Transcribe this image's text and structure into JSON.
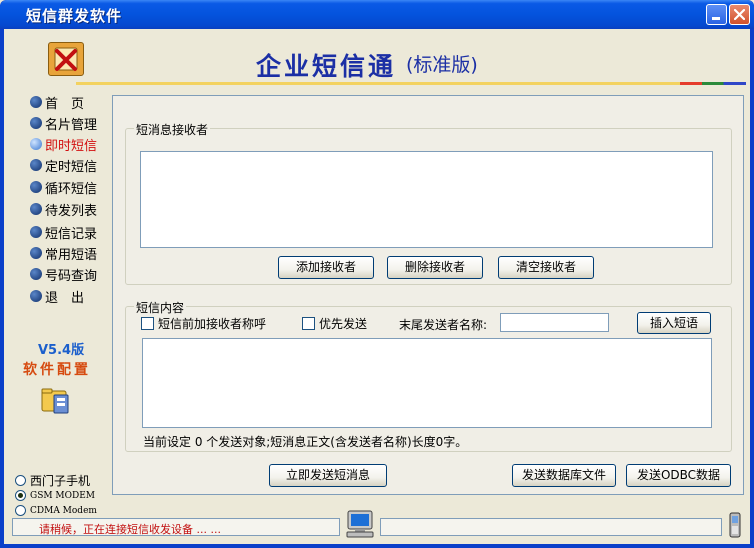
{
  "window": {
    "title": "短信群发软件"
  },
  "header": {
    "title": "企业短信通",
    "edition": "(标准版)"
  },
  "sidebar": {
    "items": [
      {
        "label": "首　页",
        "active": false
      },
      {
        "label": "名片管理",
        "active": false
      },
      {
        "label": "即时短信",
        "active": true
      },
      {
        "label": "定时短信",
        "active": false
      },
      {
        "label": "循环短信",
        "active": false
      },
      {
        "label": "待发列表",
        "active": false
      },
      {
        "label": "短信记录",
        "active": false
      },
      {
        "label": "常用短语",
        "active": false
      },
      {
        "label": "号码查询",
        "active": false
      },
      {
        "label": "退　出",
        "active": false
      }
    ],
    "version": "V5.4版",
    "config": "软件配置",
    "devices": [
      {
        "label": "西门子手机",
        "selected": false
      },
      {
        "label": "GSM MODEM",
        "selected": true
      },
      {
        "label": "CDMA Modem",
        "selected": false
      }
    ]
  },
  "recipients": {
    "legend": "短消息接收者",
    "add_button": "添加接收者",
    "delete_button": "删除接收者",
    "clear_button": "清空接收者"
  },
  "content": {
    "legend": "短信内容",
    "prefix_checkbox": "短信前加接收者称呼",
    "priority_checkbox": "优先发送",
    "sender_label": "末尾发送者名称:",
    "sender_value": "",
    "insert_button": "插入短语",
    "summary": "当前设定 0 个发送对象;短消息正文(含发送者名称)长度0字。"
  },
  "actions": {
    "send_now": "立即发送短消息",
    "send_db": "发送数据库文件",
    "send_odbc": "发送ODBC数据"
  },
  "status": {
    "message": "请稍候，正在连接短信收发设备 ... ..."
  },
  "colors": {
    "title_blue": "#1b2fa5",
    "active_red": "#d21010",
    "status_red": "#c21010"
  }
}
